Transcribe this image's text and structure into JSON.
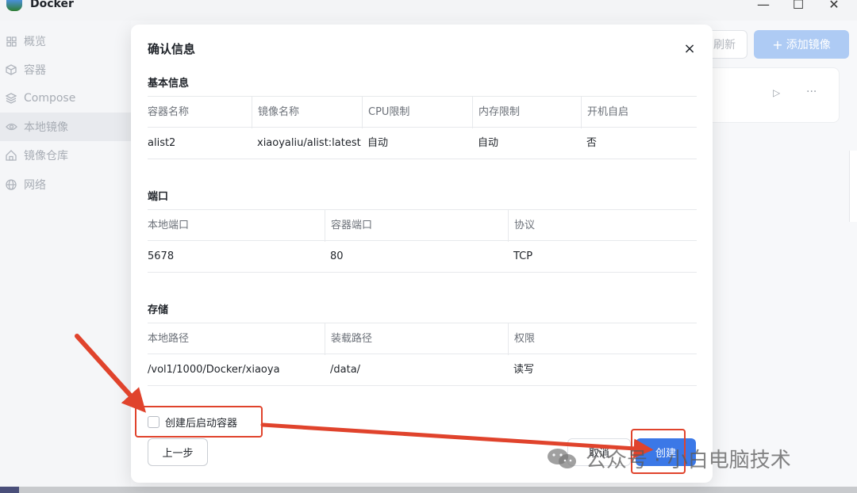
{
  "app": {
    "title": "Docker"
  },
  "window_controls": {
    "minimize": "—",
    "maximize": "☐",
    "close": "✕"
  },
  "sidebar": {
    "items": [
      {
        "label": "概览",
        "icon": "grid-icon"
      },
      {
        "label": "容器",
        "icon": "box-icon"
      },
      {
        "label": "Compose",
        "icon": "layers-icon"
      },
      {
        "label": "本地镜像",
        "icon": "eye-icon",
        "active": true
      },
      {
        "label": "镜像仓库",
        "icon": "home-icon"
      },
      {
        "label": "网络",
        "icon": "globe-icon"
      }
    ]
  },
  "main": {
    "refresh_label": "刷新",
    "add_image_label": "添加镜像",
    "add_icon": "+",
    "card_play_icon": "▷",
    "card_more_icon": "···"
  },
  "modal": {
    "title": "确认信息",
    "close_icon": "×",
    "basic": {
      "title": "基本信息",
      "headers": [
        "容器名称",
        "镜像名称",
        "CPU限制",
        "内存限制",
        "开机自启"
      ],
      "row": [
        "alist2",
        "xiaoyaliu/alist:latest",
        "自动",
        "自动",
        "否"
      ]
    },
    "ports": {
      "title": "端口",
      "headers": [
        "本地端口",
        "容器端口",
        "协议"
      ],
      "row": [
        "5678",
        "80",
        "TCP"
      ]
    },
    "storage": {
      "title": "存储",
      "headers": [
        "本地路径",
        "装载路径",
        "权限"
      ],
      "row": [
        "/vol1/1000/Docker/xiaoya",
        "/data/",
        "读写"
      ]
    },
    "start_after_create_label": "创建后启动容器",
    "start_after_create_checked": false,
    "prev_label": "上一步",
    "cancel_label": "取消",
    "create_label": "创建"
  },
  "watermark": {
    "text": "公众号 · 小白电脑技术"
  },
  "colors": {
    "annotation": "#e0432c",
    "primary": "#3b78e7"
  }
}
